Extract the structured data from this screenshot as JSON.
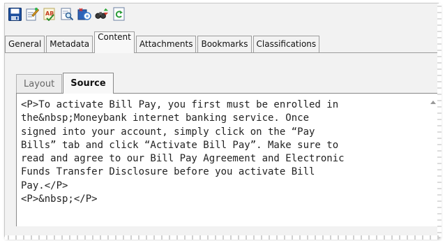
{
  "toolbar": {
    "icons": [
      "save-icon",
      "edit-document-icon",
      "spell-check-icon",
      "find-icon",
      "broadcast-icon",
      "binoculars-icon",
      "refresh-icon"
    ]
  },
  "main_tabs": [
    {
      "label": "General"
    },
    {
      "label": "Metadata"
    },
    {
      "label": "Content"
    },
    {
      "label": "Attachments"
    },
    {
      "label": "Bookmarks"
    },
    {
      "label": "Classifications"
    }
  ],
  "active_main_tab": "Content",
  "sub_tabs": [
    {
      "label": "Layout"
    },
    {
      "label": "Source"
    }
  ],
  "active_sub_tab": "Source",
  "source_text": "<P>To activate Bill Pay, you first must be enrolled in\nthe&nbsp;Moneybank internet banking service. Once\nsigned into your account, simply click on the “Pay\nBills” tab and click “Activate Bill Pay”. Make sure to\nread and agree to our Bill Pay Agreement and Electronic\nFunds Transfer Disclosure before you activate Bill\nPay.</P>\n<P>&nbsp;</P>",
  "colors": {
    "save_icon": "#1d4f9e",
    "tab_border": "#9c9c9c",
    "editor_bg": "#ffffff"
  }
}
